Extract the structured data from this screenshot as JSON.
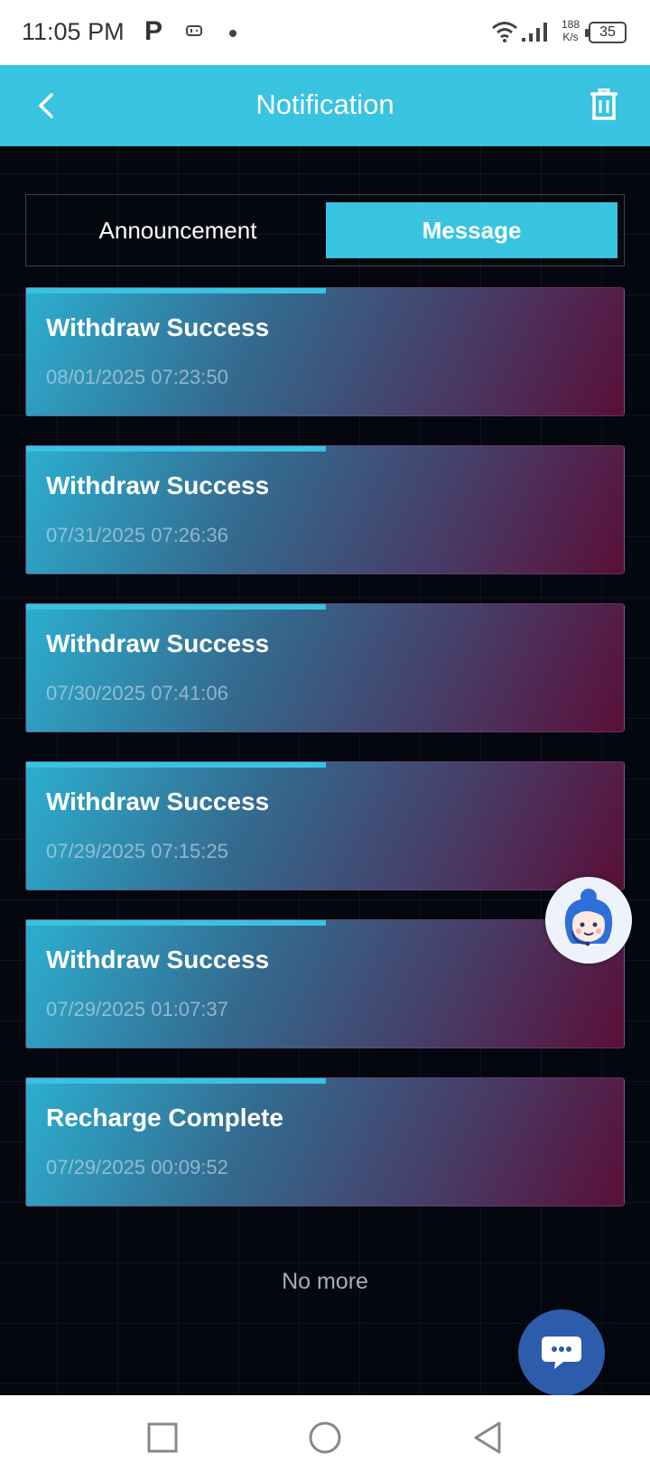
{
  "status_bar": {
    "time": "11:05 PM",
    "carrier_icon_text": "P",
    "speed_value": "188",
    "speed_unit": "K/s",
    "battery": "35"
  },
  "header": {
    "title": "Notification",
    "back_icon": "chevron-left-icon",
    "delete_icon": "trash-icon",
    "color": "#38c3e1"
  },
  "tabs": [
    {
      "label": "Announcement",
      "active": false
    },
    {
      "label": "Message",
      "active": true
    }
  ],
  "messages": [
    {
      "title": "Withdraw Success",
      "time": "08/01/2025 07:23:50"
    },
    {
      "title": "Withdraw Success",
      "time": "07/31/2025 07:26:36"
    },
    {
      "title": "Withdraw Success",
      "time": "07/30/2025 07:41:06"
    },
    {
      "title": "Withdraw Success",
      "time": "07/29/2025 07:15:25"
    },
    {
      "title": "Withdraw Success",
      "time": "07/29/2025 01:07:37"
    },
    {
      "title": "Recharge Complete",
      "time": "07/29/2025 00:09:52"
    }
  ],
  "footer": {
    "no_more": "No more"
  },
  "floating": {
    "support_icon": "customer-service-avatar-icon",
    "chat_icon": "chat-bubble-icon"
  },
  "nav": [
    "recents-square-icon",
    "home-circle-icon",
    "back-triangle-icon"
  ]
}
